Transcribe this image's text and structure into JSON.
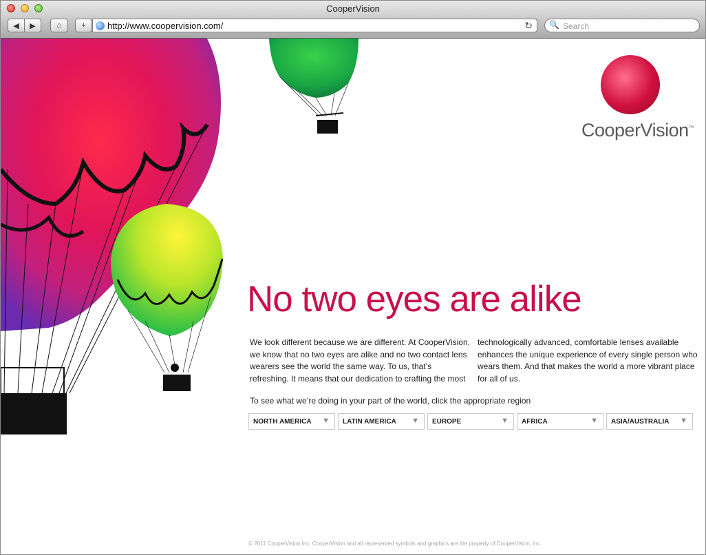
{
  "window": {
    "title": "CooperVision"
  },
  "toolbar": {
    "back_label": "◀",
    "forward_label": "▶",
    "home_label": "⌂",
    "add_label": "+",
    "url": "http://www.coopervision.com/",
    "reload_label": "↻",
    "search_placeholder": "Search"
  },
  "brand": {
    "name": "CooperVision",
    "trademark": "™",
    "color": "#c8104a"
  },
  "page": {
    "headline": "No two eyes are alike",
    "paragraph_left": "We look different because we are different. At CooperVision, we know that no two eyes are alike and no two contact lens wearers see the world the same way. To us, that’s refreshing. It means that our dedication to crafting the most",
    "paragraph_right": "technologically advanced, comfortable lenses available enhances the unique experience of every single person who wears them. And that makes the world a more vibrant place for all of us.",
    "region_prompt": "To see what we’re doing in your part of the world, click the appropriate region",
    "regions": [
      {
        "label": "NORTH AMERICA"
      },
      {
        "label": "LATIN AMERICA"
      },
      {
        "label": "EUROPE"
      },
      {
        "label": "AFRICA"
      },
      {
        "label": "ASIA/AUSTRALIA"
      }
    ],
    "footer": "© 2011 CooperVision Inc. CooperVision and all represented symbols and graphics are the property of CooperVision, Inc."
  }
}
